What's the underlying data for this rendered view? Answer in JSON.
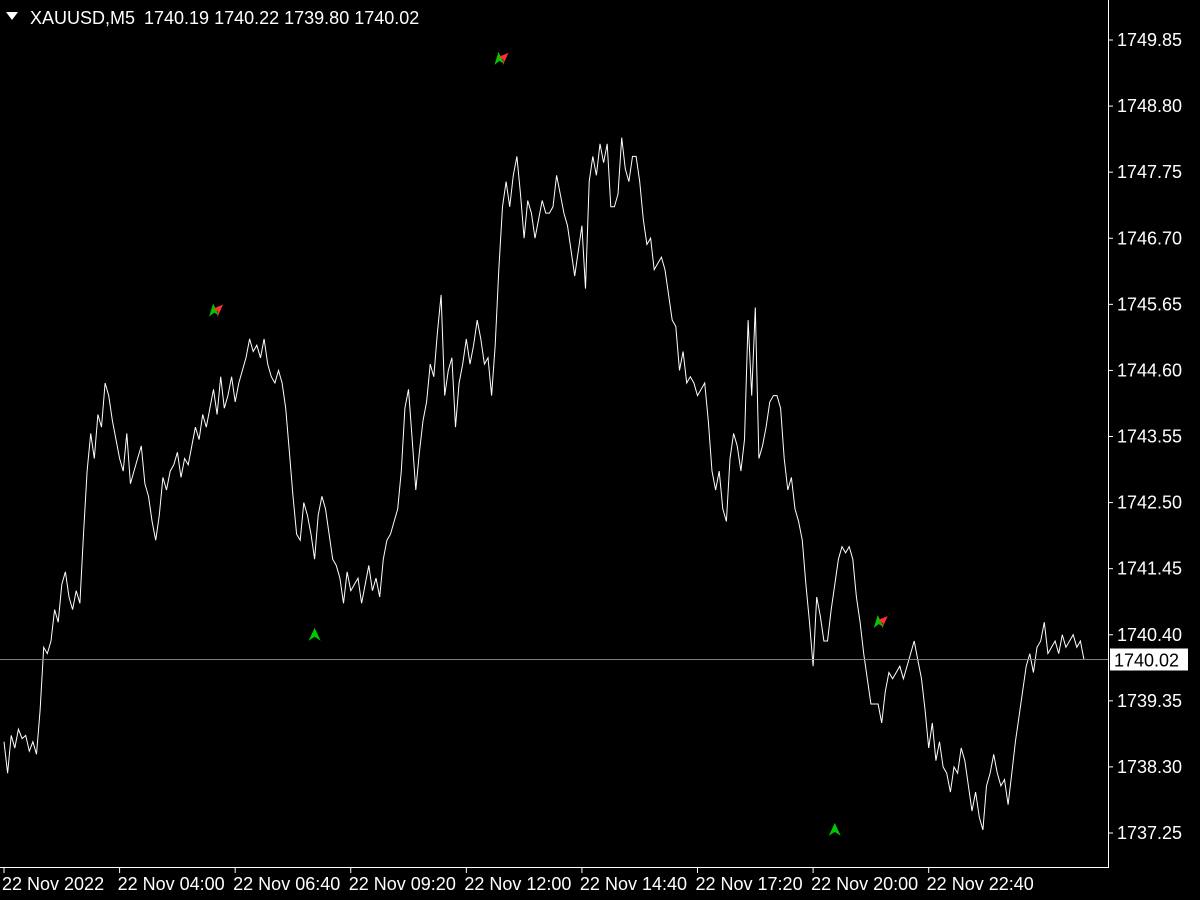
{
  "header": {
    "symbol_timeframe": "XAUUSD,M5",
    "ohlc": "1740.19 1740.22 1739.80 1740.02"
  },
  "current_price_label": "1740.02",
  "colors": {
    "background": "#000000",
    "line": "#ffffff",
    "axis": "#ffffff",
    "bid_line": "#7f7f7f",
    "arrow_green": "#00c800",
    "arrow_red": "#ff3030"
  },
  "chart_data": {
    "type": "line",
    "title": "XAUUSD,M5",
    "xlabel": "",
    "ylabel": "",
    "ylim": [
      1736.75,
      1750.5
    ],
    "grid": false,
    "y_ticks": [
      "1749.85",
      "1748.80",
      "1747.75",
      "1746.70",
      "1745.65",
      "1744.60",
      "1743.55",
      "1742.50",
      "1741.45",
      "1740.40",
      "1739.35",
      "1738.30",
      "1737.25"
    ],
    "x_ticks": [
      "22 Nov 2022",
      "22 Nov 04:00",
      "22 Nov 06:40",
      "22 Nov 09:20",
      "22 Nov 12:00",
      "22 Nov 14:40",
      "22 Nov 17:20",
      "22 Nov 20:00",
      "22 Nov 22:40"
    ],
    "x_tick_bar_index": [
      0,
      32,
      64,
      96,
      128,
      160,
      192,
      224,
      256
    ],
    "current_price": 1740.02,
    "series": [
      {
        "values": [
          1738.7,
          1738.2,
          1738.8,
          1738.6,
          1738.9,
          1738.75,
          1738.8,
          1738.55,
          1738.7,
          1738.5,
          1739.2,
          1740.2,
          1740.1,
          1740.3,
          1740.8,
          1740.6,
          1741.2,
          1741.4,
          1741.0,
          1740.8,
          1741.1,
          1740.9,
          1742.0,
          1743.0,
          1743.6,
          1743.2,
          1743.9,
          1743.7,
          1744.4,
          1744.2,
          1743.8,
          1743.5,
          1743.2,
          1743.0,
          1743.6,
          1742.8,
          1743.0,
          1743.2,
          1743.4,
          1742.8,
          1742.6,
          1742.2,
          1741.9,
          1742.3,
          1742.9,
          1742.7,
          1743.0,
          1743.1,
          1743.3,
          1742.9,
          1743.2,
          1743.1,
          1743.4,
          1743.7,
          1743.5,
          1743.9,
          1743.7,
          1744.0,
          1744.3,
          1743.9,
          1744.5,
          1744.0,
          1744.2,
          1744.5,
          1744.1,
          1744.4,
          1744.6,
          1744.8,
          1745.1,
          1744.9,
          1745.0,
          1744.8,
          1745.1,
          1744.7,
          1744.5,
          1744.4,
          1744.6,
          1744.4,
          1744.0,
          1743.3,
          1742.6,
          1742.0,
          1741.9,
          1742.5,
          1742.3,
          1742.0,
          1741.6,
          1742.3,
          1742.6,
          1742.4,
          1742.0,
          1741.6,
          1741.5,
          1741.3,
          1740.9,
          1741.4,
          1741.1,
          1741.2,
          1741.3,
          1740.9,
          1741.2,
          1741.5,
          1741.1,
          1741.3,
          1741.0,
          1741.6,
          1741.9,
          1742.0,
          1742.2,
          1742.4,
          1743.0,
          1744.0,
          1744.3,
          1743.5,
          1742.7,
          1743.3,
          1743.8,
          1744.1,
          1744.7,
          1744.5,
          1745.2,
          1745.8,
          1744.2,
          1744.6,
          1744.8,
          1743.7,
          1744.4,
          1744.7,
          1745.1,
          1744.7,
          1745.0,
          1745.4,
          1745.1,
          1744.7,
          1744.8,
          1744.2,
          1745.0,
          1746.2,
          1747.2,
          1747.6,
          1747.2,
          1747.7,
          1748.0,
          1747.4,
          1746.7,
          1747.3,
          1747.1,
          1746.7,
          1747.0,
          1747.3,
          1747.1,
          1747.1,
          1747.2,
          1747.7,
          1747.4,
          1747.1,
          1746.9,
          1746.5,
          1746.1,
          1746.5,
          1746.9,
          1745.9,
          1747.6,
          1748.0,
          1747.7,
          1748.2,
          1747.9,
          1748.2,
          1747.2,
          1747.2,
          1747.4,
          1748.3,
          1747.8,
          1747.6,
          1748.0,
          1748.0,
          1747.6,
          1747.0,
          1746.6,
          1746.7,
          1746.2,
          1746.3,
          1746.4,
          1746.2,
          1745.8,
          1745.4,
          1745.3,
          1744.6,
          1744.9,
          1744.4,
          1744.5,
          1744.4,
          1744.2,
          1744.3,
          1744.4,
          1743.8,
          1743.0,
          1742.7,
          1743.0,
          1742.4,
          1742.2,
          1743.2,
          1743.6,
          1743.4,
          1743.0,
          1743.5,
          1745.4,
          1744.2,
          1745.6,
          1743.2,
          1743.4,
          1743.7,
          1744.1,
          1744.2,
          1744.2,
          1744.0,
          1743.2,
          1742.7,
          1742.9,
          1742.4,
          1742.2,
          1741.9,
          1741.2,
          1740.6,
          1739.9,
          1741.0,
          1740.7,
          1740.3,
          1740.3,
          1740.8,
          1741.2,
          1741.6,
          1741.8,
          1741.7,
          1741.8,
          1741.6,
          1741.0,
          1740.6,
          1740.1,
          1739.7,
          1739.3,
          1739.3,
          1739.3,
          1739.0,
          1739.5,
          1739.8,
          1739.7,
          1739.8,
          1739.9,
          1739.7,
          1739.9,
          1740.1,
          1740.3,
          1740.0,
          1739.7,
          1739.2,
          1738.6,
          1739.0,
          1738.4,
          1738.7,
          1738.3,
          1738.2,
          1737.9,
          1738.3,
          1738.2,
          1738.6,
          1738.4,
          1738.0,
          1737.6,
          1737.9,
          1737.5,
          1737.3,
          1738.0,
          1738.2,
          1738.5,
          1738.2,
          1738.0,
          1738.1,
          1737.7,
          1738.2,
          1738.7,
          1739.1,
          1739.5,
          1739.9,
          1740.1,
          1739.8,
          1740.2,
          1740.3,
          1740.6,
          1740.1,
          1740.2,
          1740.3,
          1740.1,
          1740.4,
          1740.2,
          1740.3,
          1740.4,
          1740.2,
          1740.3,
          1740.0
        ],
        "color": "#ffffff"
      }
    ],
    "signal_arrows": [
      {
        "bar": 59,
        "type": "mixed",
        "price": 1745.55
      },
      {
        "bar": 86,
        "type": "buy",
        "price": 1740.4
      },
      {
        "bar": 138,
        "type": "mixed",
        "price": 1749.55
      },
      {
        "bar": 230,
        "type": "buy",
        "price": 1737.3
      },
      {
        "bar": 243,
        "type": "mixed",
        "price": 1740.6
      }
    ]
  }
}
